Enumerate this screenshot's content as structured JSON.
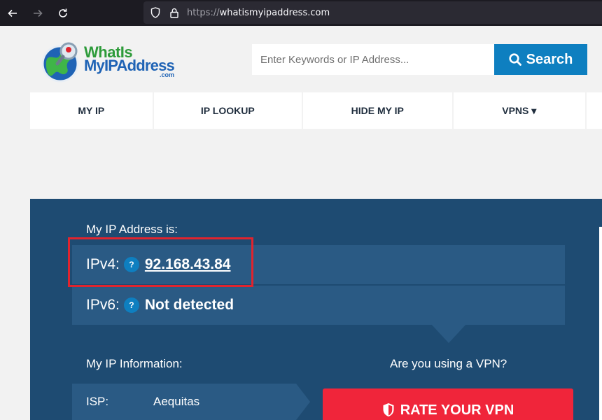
{
  "browser": {
    "url_scheme": "https://",
    "url_host": "whatismyipaddress.com"
  },
  "logo": {
    "line1": "WhatIs",
    "line2": "MyIPAddress",
    "line3": ".com"
  },
  "search": {
    "placeholder": "Enter Keywords or IP Address...",
    "button_label": "Search"
  },
  "menu": {
    "items": [
      {
        "label": "MY IP"
      },
      {
        "label": "IP LOOKUP"
      },
      {
        "label": "HIDE MY IP"
      },
      {
        "label": "VPNS ▾"
      }
    ]
  },
  "panel": {
    "heading": "My IP Address is:",
    "ipv4_label": "IPv4:",
    "ipv4_value": "92.168.43.84",
    "ipv6_label": "IPv6:",
    "ipv6_value": "Not detected",
    "help_glyph": "?",
    "info_heading": "My IP Information:",
    "vpn_question": "Are you using a VPN?",
    "isp_key": "ISP:",
    "isp_value": "Aequitas",
    "vpn_button": "RATE YOUR VPN"
  },
  "colors": {
    "panel_bg": "#1e4b72",
    "row_bg": "#2a5a84",
    "accent_blue": "#0e7fc0",
    "cta_red": "#f0253a",
    "highlight_red": "#e0242e"
  }
}
